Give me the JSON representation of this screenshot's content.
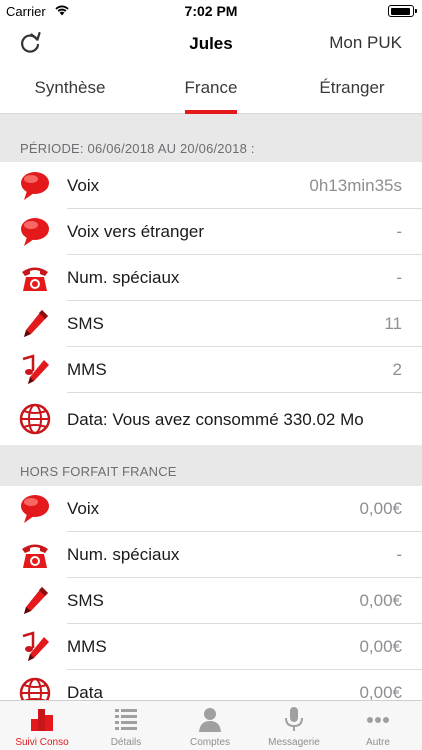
{
  "status_bar": {
    "carrier": "Carrier",
    "time": "7:02 PM",
    "battery_level": 0.95,
    "wifi_icon": "wifi-icon"
  },
  "nav": {
    "title": "Jules",
    "right_button": "Mon PUK",
    "left_icon": "refresh-icon"
  },
  "tabs": [
    {
      "label": "Synthèse",
      "selected": false
    },
    {
      "label": "France",
      "selected": true
    },
    {
      "label": "Étranger",
      "selected": false
    }
  ],
  "sections": [
    {
      "header": "PÉRIODE: 06/06/2018 AU 20/06/2018 :",
      "rows": [
        {
          "icon": "speech-bubble-icon",
          "label": "Voix",
          "value": "0h13min35s"
        },
        {
          "icon": "speech-bubble-icon",
          "label": "Voix vers étranger",
          "value": "-"
        },
        {
          "icon": "telephone-icon",
          "label": "Num. spéciaux",
          "value": "-"
        },
        {
          "icon": "pen-icon",
          "label": "SMS",
          "value": "11"
        },
        {
          "icon": "music-pen-icon",
          "label": "MMS",
          "value": "2"
        },
        {
          "icon": "globe-icon",
          "label": "Data: Vous avez consommé 330.02 Mo",
          "value": ""
        }
      ]
    },
    {
      "header": "HORS FORFAIT FRANCE",
      "rows": [
        {
          "icon": "speech-bubble-icon",
          "label": "Voix",
          "value": "0,00€"
        },
        {
          "icon": "telephone-icon",
          "label": "Num. spéciaux",
          "value": "-"
        },
        {
          "icon": "pen-icon",
          "label": "SMS",
          "value": "0,00€"
        },
        {
          "icon": "music-pen-icon",
          "label": "MMS",
          "value": "0,00€"
        },
        {
          "icon": "globe-icon",
          "label": "Data",
          "value": "0,00€"
        }
      ]
    }
  ],
  "tab_bar": [
    {
      "label": "Suivi Conso",
      "icon": "bar-chart-icon",
      "active": true
    },
    {
      "label": "Détails",
      "icon": "list-icon",
      "active": false
    },
    {
      "label": "Comptes",
      "icon": "person-icon",
      "active": false
    },
    {
      "label": "Messagerie",
      "icon": "microphone-icon",
      "active": false
    },
    {
      "label": "Autre",
      "icon": "more-dots-icon",
      "active": false
    }
  ],
  "colors": {
    "accent": "#e3191c",
    "section_bg": "#e8e8e8",
    "value_gray": "#8e8e93"
  }
}
